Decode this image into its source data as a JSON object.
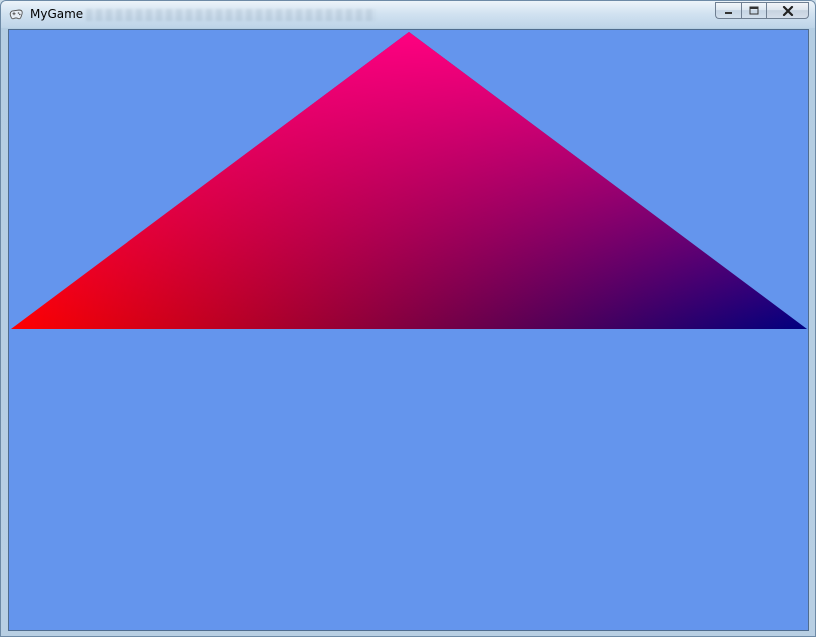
{
  "window": {
    "title": "MyGame",
    "icon": "gamepad-icon",
    "buttons": [
      "minimize-icon",
      "maximize-icon",
      "close-icon"
    ]
  },
  "scene": {
    "clear_color": "#6495ED",
    "triangle": {
      "vertex_colors": {
        "top": "#FF0080",
        "bottom_left": "#FF0000",
        "bottom_right": "#000080"
      }
    }
  }
}
